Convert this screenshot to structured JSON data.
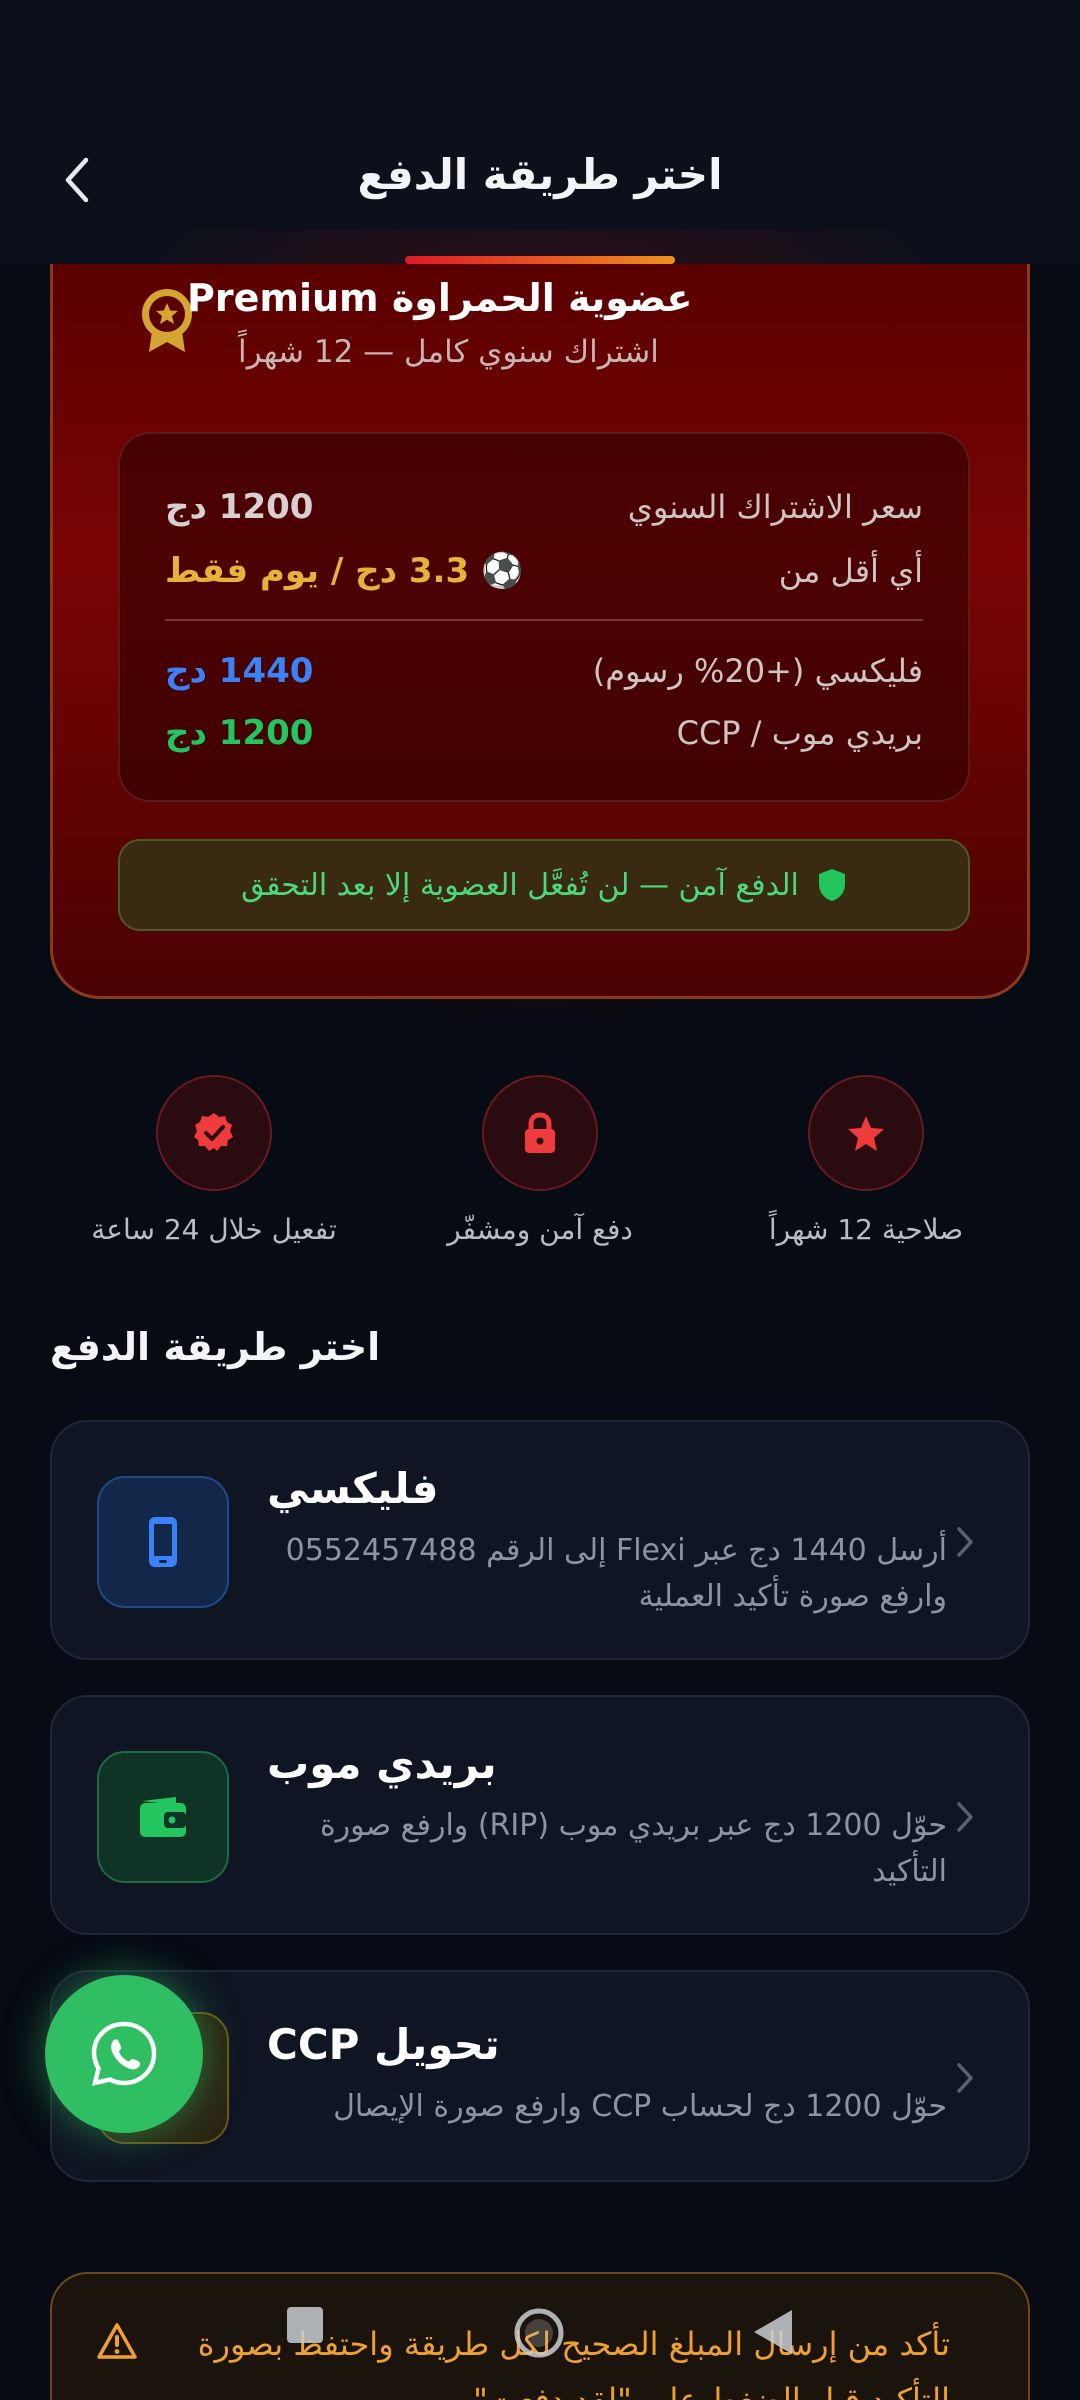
{
  "header": {
    "title": "اختر طريقة الدفع"
  },
  "membership": {
    "title": "عضوية الحمراوة Premium",
    "subtitle": "اشتراك سنوي كامل — 12 شهراً",
    "rows": [
      {
        "label": "سعر الاشتراك السنوي",
        "value": "1200 دج",
        "color": "#d8d0d0"
      },
      {
        "label": "أي أقل من",
        "value": "⚽ 3.3 دج / يوم فقط",
        "color": "#e8b23a"
      },
      {
        "label": "فليكسي (+20% رسوم)",
        "value": "1440 دج",
        "color": "#3b82f6"
      },
      {
        "label": "بريدي موب / CCP",
        "value": "1200 دج",
        "color": "#22c55e"
      }
    ],
    "secure_note": "الدفع آمن — لن تُفعَّل العضوية إلا بعد التحقق"
  },
  "features": [
    {
      "icon": "star-icon",
      "label": "صلاحية 12 شهراً"
    },
    {
      "icon": "lock-icon",
      "label": "دفع آمن ومشفّر"
    },
    {
      "icon": "verified-badge-icon",
      "label": "تفعيل خلال 24 ساعة"
    }
  ],
  "section_title": "اختر طريقة الدفع",
  "methods": [
    {
      "icon": "phone-icon",
      "title": "فليكسي",
      "desc": "أرسل 1440 دج عبر Flexi إلى الرقم 0552457488 وارفع صورة تأكيد العملية",
      "accent": "#3b82f6"
    },
    {
      "icon": "wallet-icon",
      "title": "بريدي موب",
      "desc": "حوّل 1200 دج عبر بريدي موب (RIP) وارفع صورة التأكيد",
      "accent": "#22c55e"
    },
    {
      "icon": "bank-icon",
      "title": "تحويل CCP",
      "desc": "حوّل 1200 دج لحساب CCP وارفع صورة الإيصال",
      "accent": "#e8b23a"
    }
  ],
  "warning": {
    "text": "تأكد من إرسال المبلغ الصحيح لكل طريقة واحتفظ بصورة التأكيد قبل الضغط على \"لقد دفعت\""
  }
}
